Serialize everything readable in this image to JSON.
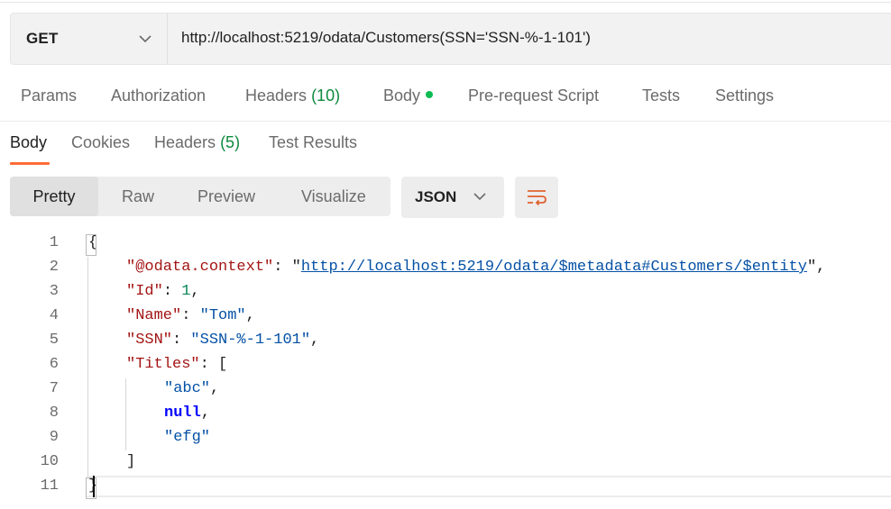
{
  "request": {
    "method": "GET",
    "url": "http://localhost:5219/odata/Customers(SSN='SSN-%-1-101')"
  },
  "request_tabs": [
    {
      "label": "Params"
    },
    {
      "label": "Authorization"
    },
    {
      "label": "Headers",
      "count": "(10)"
    },
    {
      "label": "Body"
    },
    {
      "label": "Pre-request Script"
    },
    {
      "label": "Tests"
    },
    {
      "label": "Settings"
    }
  ],
  "response_tabs": [
    {
      "label": "Body",
      "active": true
    },
    {
      "label": "Cookies"
    },
    {
      "label": "Headers",
      "count": "(5)"
    },
    {
      "label": "Test Results"
    }
  ],
  "view_modes": [
    "Pretty",
    "Raw",
    "Preview",
    "Visualize"
  ],
  "active_view": "Pretty",
  "format": "JSON",
  "icons": {
    "method_dropdown": "chevron-down-icon",
    "format_dropdown": "chevron-down-icon",
    "wrap": "text-wrap-icon",
    "body_indicator": "green-dot-icon"
  },
  "colors": {
    "accent": "#ff6c37",
    "count": "#0f8a3e",
    "json_key": "#a31515",
    "json_string": "#0451a5",
    "json_number": "#098658",
    "json_keyword": "#0000ff"
  },
  "response_body": {
    "line_numbers": [
      "1",
      "2",
      "3",
      "4",
      "5",
      "6",
      "7",
      "8",
      "9",
      "10",
      "11"
    ],
    "open_brace": "{",
    "close_brace": "}",
    "context_key": "\"@odata.context\"",
    "context_value": "http://localhost:5219/odata/$metadata#Customers/$entity",
    "id_key": "\"Id\"",
    "id_value": "1",
    "name_key": "\"Name\"",
    "name_value": "\"Tom\"",
    "ssn_key": "\"SSN\"",
    "ssn_value": "\"SSN-%-1-101\"",
    "titles_key": "\"Titles\"",
    "titles_open": "[",
    "titles_items": [
      "\"abc\"",
      "null",
      "\"efg\""
    ],
    "titles_close": "]"
  }
}
